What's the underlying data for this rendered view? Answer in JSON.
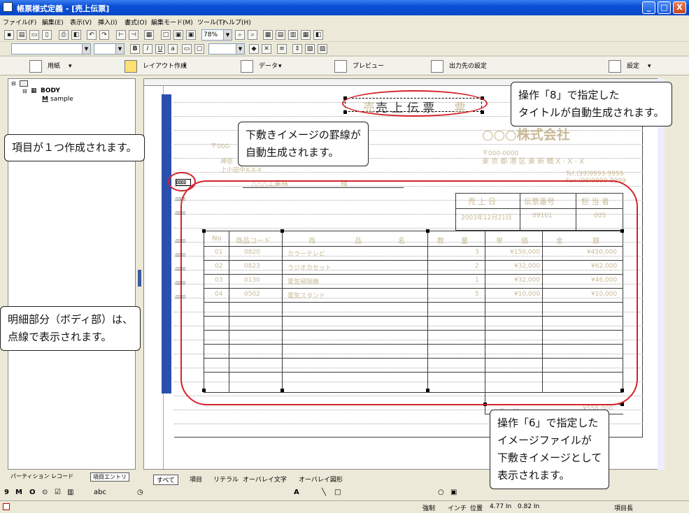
{
  "window": {
    "title": "帳票様式定義 - [売上伝票]",
    "controls": [
      "_",
      "□",
      "X"
    ]
  },
  "menu": [
    "ファイル(F)",
    "編集(E)",
    "表示(V)",
    "挿入(I)",
    "書式(O)",
    "編集モード(M)",
    "ツール(T)",
    "ヘルプ(H)"
  ],
  "toolbar": {
    "zoom": "78%"
  },
  "ribbon": {
    "paper": "用紙",
    "layout": "レイアウト作成",
    "data": "データ",
    "preview": "プレビュー",
    "output": "出力先の設定",
    "settings": "設定"
  },
  "tree": {
    "root": "BODY",
    "child": "sample"
  },
  "panel_tabs": [
    "パーティション",
    "レコード",
    "項目エントリ"
  ],
  "report": {
    "title": "売 上 伝 票",
    "title_prefix": "売",
    "title_suffix": "票",
    "company": "○○○株式会社",
    "postal": "〒000-0000",
    "address": "東 京 都 港 区 東 新 橋 X - X - X",
    "tel": "Tel:(99)9999-9999",
    "fax": "Fax:(99)9999-9999",
    "left_postal": "〒000-",
    "left_addr1": "神奈",
    "left_addr2": "上小田中X-X-X",
    "customer": "△△△工業株",
    "sama": "様",
    "item_label": "顧客名",
    "field_marks": "ﾛﾛﾛﾛ",
    "info_head": [
      "売 上 日",
      "伝票番号",
      "担 当 者"
    ],
    "info_vals": [
      "2003年12月21日",
      "09101",
      "005"
    ],
    "col_head": [
      "No",
      "商品コード",
      "商",
      "品",
      "名",
      "数",
      "量",
      "単",
      "価",
      "金",
      "額"
    ],
    "rows": [
      {
        "no": "01",
        "code": "0820",
        "name": "カラーテレビ",
        "qty": "3",
        "price": "¥150,000",
        "amt": "¥450,000"
      },
      {
        "no": "02",
        "code": "0823",
        "name": "ラジオカセット",
        "qty": "2",
        "price": "¥32,000",
        "amt": "¥62,000"
      },
      {
        "no": "03",
        "code": "0130",
        "name": "電気掃除機",
        "qty": "1",
        "price": "¥32,000",
        "amt": "¥46,000"
      },
      {
        "no": "04",
        "code": "0502",
        "name": "電気スタンド",
        "qty": "5",
        "price": "¥10,000",
        "amt": "¥10,000"
      }
    ],
    "total_label": "合　計",
    "total": "¥558,000"
  },
  "callouts": {
    "c1": [
      "操作「8」で指定した",
      "タイトルが自動生成されます。"
    ],
    "c2": [
      "下敷きイメージの罫線が",
      "自動生成されます。"
    ],
    "c3": "項目が１つ作成されます。",
    "c4": [
      "明細部分（ボディ部）は、",
      "点線で表示されます。"
    ],
    "c5": [
      "操作「6」で指定した",
      "イメージファイルが",
      "下敷きイメージとして",
      "表示されます。"
    ]
  },
  "bottom_tabs": [
    "すべて",
    "項目",
    "リテラル",
    "オーバレイ文字",
    "オーバレイ図形"
  ],
  "status": {
    "mode": "強制",
    "unit": "インチ",
    "pos_label": "位置",
    "x": "4.77 In",
    "y": "0.82 In",
    "field": "項目長"
  }
}
